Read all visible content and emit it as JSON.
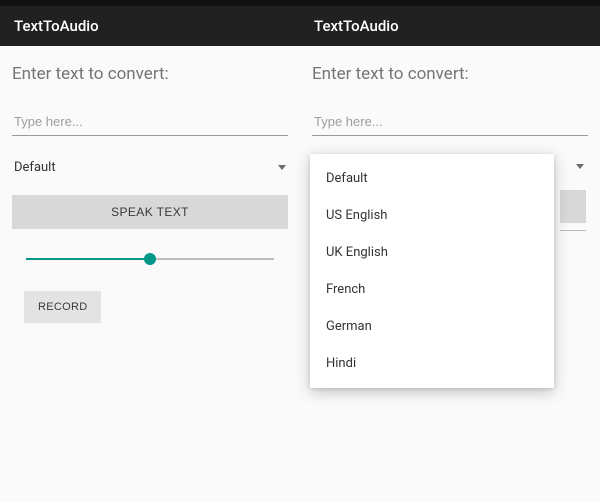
{
  "app": {
    "title": "TextToAudio"
  },
  "heading": "Enter text to convert:",
  "input": {
    "placeholder": "Type here...",
    "value": ""
  },
  "spinner": {
    "selected": "Default"
  },
  "buttons": {
    "speak": "SPEAK TEXT",
    "record": "RECORD"
  },
  "slider": {
    "percent": 50
  },
  "dropdown": {
    "options": [
      "Default",
      "US English",
      "UK English",
      "French",
      "German",
      "Hindi"
    ]
  }
}
